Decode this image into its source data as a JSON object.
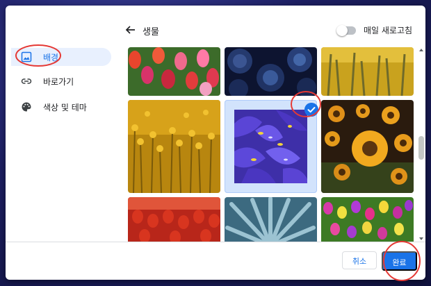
{
  "header": {
    "title": "생물",
    "back_icon": "arrow-left-icon",
    "daily_refresh_label": "매일 새로고침",
    "daily_refresh_on": false
  },
  "sidebar": {
    "items": [
      {
        "label": "배경",
        "icon": "image-icon",
        "active": true
      },
      {
        "label": "바로가기",
        "icon": "link-icon",
        "active": false
      },
      {
        "label": "색상 및 테마",
        "icon": "palette-icon",
        "active": false
      }
    ]
  },
  "gallery": {
    "tiles": [
      {
        "subject": "tulips-pink-red",
        "selected": false
      },
      {
        "subject": "succulents-dark-blue",
        "selected": false
      },
      {
        "subject": "yellow-grass-blur",
        "selected": false
      },
      {
        "subject": "yellow-flowers-field",
        "selected": false
      },
      {
        "subject": "purple-iris",
        "selected": true
      },
      {
        "subject": "sunflowers",
        "selected": false
      },
      {
        "subject": "red-tulips-field",
        "selected": false
      },
      {
        "subject": "blue-agave",
        "selected": false
      },
      {
        "subject": "colorful-tulips",
        "selected": false
      }
    ],
    "check_icon": "check-circle-icon"
  },
  "footer": {
    "cancel_label": "취소",
    "done_label": "완료"
  },
  "colors": {
    "accent": "#1a73e8",
    "annotation": "#e53935"
  }
}
